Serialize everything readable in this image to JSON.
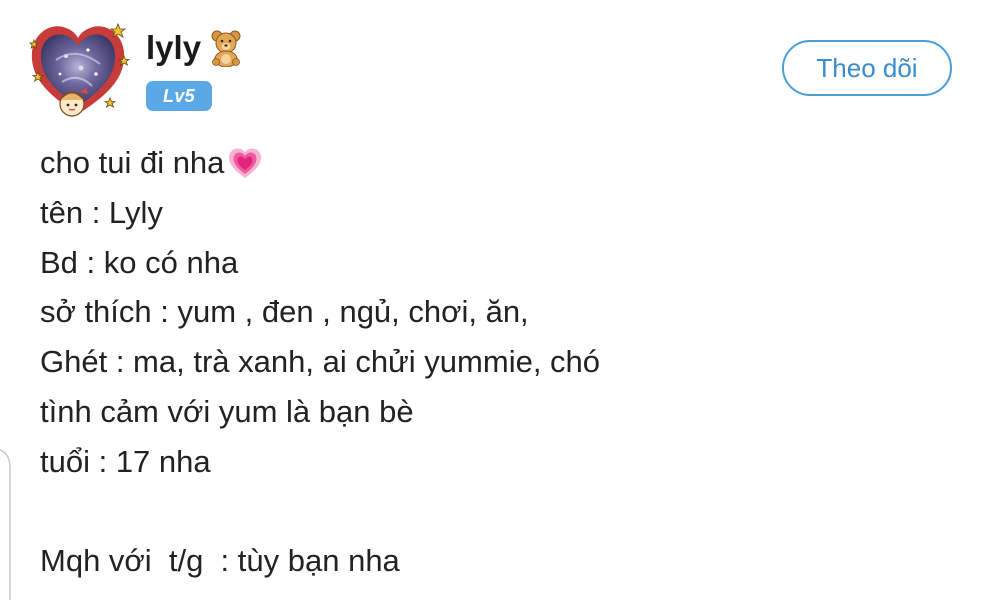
{
  "post": {
    "author": {
      "name": "lyly",
      "level": "Lv5",
      "name_emoji_icon": "teddy-bear-icon",
      "avatar_icon": "decorated-avatar-icon"
    },
    "follow_label": "Theo dõi",
    "content_lines": [
      "cho tui đi nha",
      "tên : Lyly",
      "Bd : ko có nha",
      "sở thích : yum , đen , ngủ, chơi, ăn,",
      "Ghét : ma, trà xanh, ai chửi yummie, chó",
      "tình cảm với yum là bạn bè",
      "tuổi : 17 nha",
      "",
      "Mqh với  t/g  : tùy bạn nha"
    ],
    "first_line_emoji_icon": "growing-heart-icon"
  },
  "colors": {
    "accent": "#4a9fd9",
    "level_badge": "#5aa9e6",
    "text": "#222222"
  }
}
